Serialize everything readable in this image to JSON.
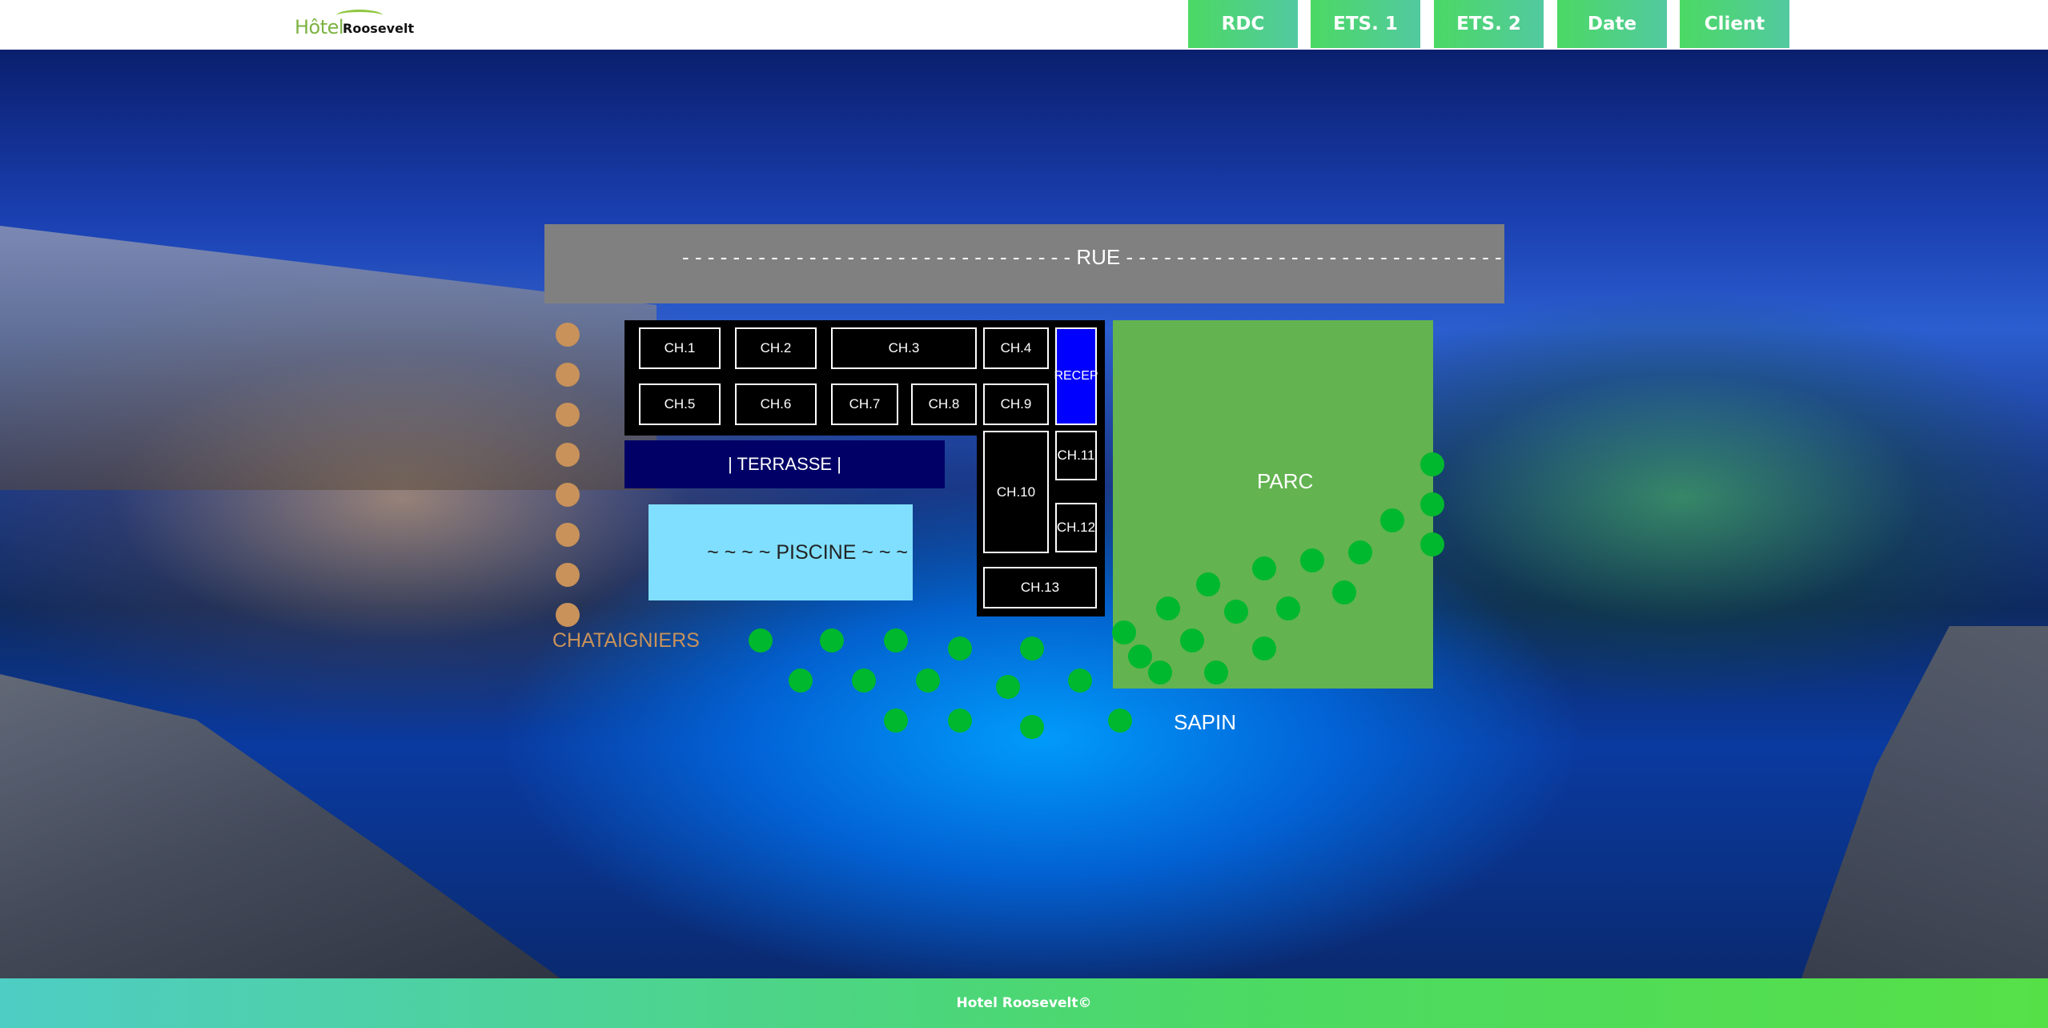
{
  "header": {
    "logo_part1": "Hôtel",
    "logo_part2": "Roosevelt",
    "nav": [
      "RDC",
      "ETS. 1",
      "ETS. 2",
      "Date",
      "Client"
    ]
  },
  "map": {
    "rue": "- - - - - - - - - - - - - - - - - - - - - - - - - - - - - - - RUE - - - - - - - - - - - - - - - - - - - - - - - - - - - - - - - - - -",
    "rooms": [
      "CH.1",
      "CH.2",
      "CH.3",
      "CH.4",
      "CH.5",
      "CH.6",
      "CH.7",
      "CH.8",
      "CH.9",
      "CH.10",
      "CH.11",
      "CH.12",
      "CH.13"
    ],
    "reception": "RECEP",
    "terrasse": "| TERRASSE |",
    "piscine": "~ ~ ~ ~ PISCINE ~ ~ ~",
    "parc": "PARC",
    "chataigniers": "CHATAIGNIERS",
    "sapin": "SAPIN"
  },
  "colors": {
    "nav_gradient_start": "#4cd964",
    "nav_gradient_end": "#52c9a0",
    "rue": "#808080",
    "room_bg": "#000000",
    "reception": "#0000ff",
    "terrasse": "#000066",
    "piscine": "#80dfff",
    "parc": "#63b350",
    "chataignier_dot": "#c8925a",
    "sapin_dot": "#00b82e"
  },
  "footer": {
    "text": "Hotel Roosevelt©"
  }
}
